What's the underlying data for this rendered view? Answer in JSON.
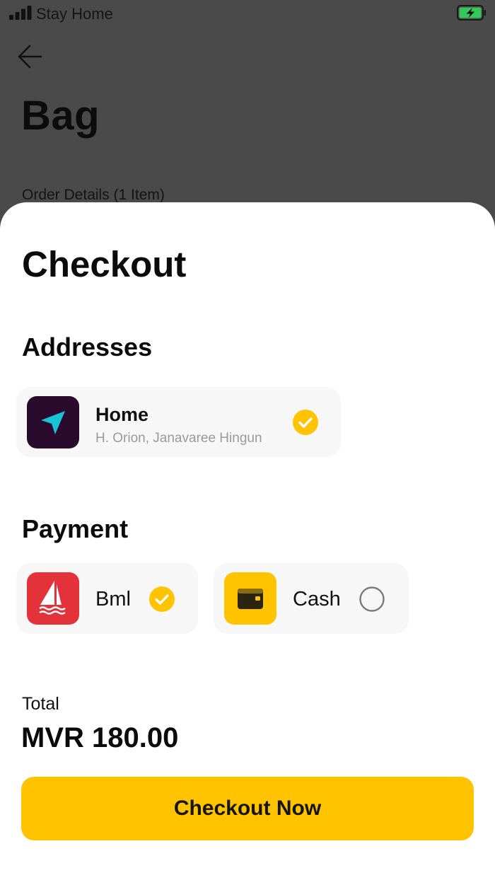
{
  "status_bar": {
    "carrier": "Stay Home",
    "icons": [
      "signal-icon",
      "battery-charging-icon"
    ]
  },
  "background_screen": {
    "title": "Bag",
    "subtitle": "Order Details (1 Item)",
    "back_icon": "arrow-left-icon"
  },
  "checkout": {
    "title": "Checkout",
    "addresses_title": "Addresses",
    "address": {
      "name": "Home",
      "line": "H. Orion, Janavaree Hingun",
      "icon": "navigation-arrow-icon",
      "selected": true
    },
    "payment_title": "Payment",
    "payment_methods": [
      {
        "label": "Bml",
        "icon": "sailboat-logo-icon",
        "selected": true
      },
      {
        "label": "Cash",
        "icon": "wallet-icon",
        "selected": false
      }
    ],
    "total_label": "Total",
    "total_amount": "MVR 180.00",
    "button_label": "Checkout Now"
  },
  "colors": {
    "accent": "#FFC300",
    "overlay": "#4A4A4A",
    "card_background": "#F7F7F7",
    "nav_tile": "#2A0B2E",
    "nav_arrow": "#19C3D6",
    "bml_tile": "#E3323A",
    "battery": "#35C759",
    "secondary_text": "#9A9A9A"
  }
}
